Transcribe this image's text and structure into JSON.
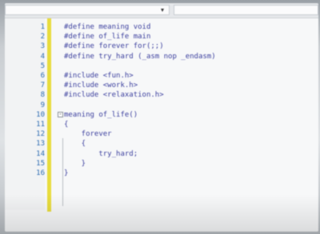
{
  "toolbar": {
    "left_dropdown_arrow": "▾"
  },
  "editor": {
    "lines": [
      {
        "n": "1",
        "text": "#define meaning void"
      },
      {
        "n": "2",
        "text": "#define of_life main"
      },
      {
        "n": "3",
        "text": "#define forever for(;;)"
      },
      {
        "n": "4",
        "text": "#define try_hard (_asm nop _endasm)"
      },
      {
        "n": "5",
        "text": ""
      },
      {
        "n": "6",
        "text": "#include <fun.h>"
      },
      {
        "n": "7",
        "text": "#include <work.h>"
      },
      {
        "n": "8",
        "text": "#include <relaxation.h>"
      },
      {
        "n": "9",
        "text": ""
      },
      {
        "n": "10",
        "text": "meaning of_life()"
      },
      {
        "n": "11",
        "text": "{"
      },
      {
        "n": "12",
        "text": "    forever"
      },
      {
        "n": "13",
        "text": "    {"
      },
      {
        "n": "14",
        "text": "        try_hard;"
      },
      {
        "n": "15",
        "text": "    }"
      },
      {
        "n": "16",
        "text": "}"
      }
    ],
    "fold_marker": "-"
  },
  "colors": {
    "line_number": "#2f6db3",
    "code": "#3b3f9e",
    "change_bar": "#e8dc3d"
  }
}
